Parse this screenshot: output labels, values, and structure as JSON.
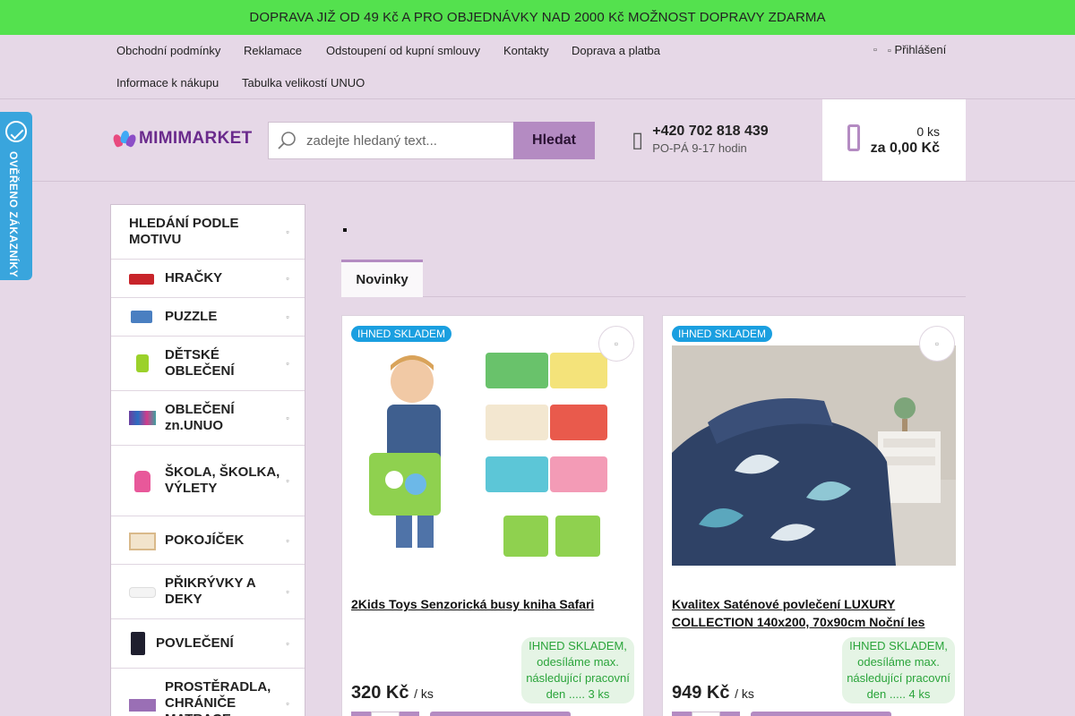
{
  "promo": "DOPRAVA JIŽ OD 49 Kč A PRO OBJEDNÁVKY NAD 2000 Kč MOŽNOST DOPRAVY ZDARMA",
  "topnav": {
    "links": [
      "Obchodní podmínky",
      "Reklamace",
      "Odstoupení od kupní smlouvy",
      "Kontakty",
      "Doprava a platba",
      "Informace k nákupu",
      "Tabulka velikostí UNUO"
    ],
    "login": "Přihlášení"
  },
  "header": {
    "logo": "MIMIMARKET",
    "search_placeholder": "zadejte hledaný text...",
    "search_button": "Hledat",
    "phone": "+420 702 818 439",
    "hours": "PO-PÁ 9-17 hodin",
    "cart_count": "0 ks",
    "cart_total": "za 0,00 Kč"
  },
  "verified_badge": "OVĚŘENO ZÁKAZNÍKY",
  "sidebar": {
    "items": [
      {
        "label": "HLEDÁNÍ PODLE MOTIVU",
        "thumb": "none"
      },
      {
        "label": "HRAČKY",
        "thumb": "truck"
      },
      {
        "label": "PUZZLE",
        "thumb": "puzzle"
      },
      {
        "label": "DĚTSKÉ OBLEČENÍ",
        "thumb": "jacket"
      },
      {
        "label": "OBLEČENÍ zn.UNUO",
        "thumb": "kids"
      },
      {
        "label": "ŠKOLA, ŠKOLKA, VÝLETY",
        "thumb": "backpack"
      },
      {
        "label": "POKOJÍČEK",
        "thumb": "crib"
      },
      {
        "label": "PŘIKRÝVKY A DEKY",
        "thumb": "blanket"
      },
      {
        "label": "POVLEČENÍ",
        "thumb": "bedding"
      },
      {
        "label": "PROSTĚRADLA, CHRÁNIČE MATRACE",
        "thumb": "sheet"
      }
    ]
  },
  "main": {
    "tab": "Novinky",
    "products": [
      {
        "badge": "IHNED SKLADEM",
        "title": "2Kids Toys Senzorická busy kniha Safari",
        "availability": "IHNED SKLADEM, odesíláme max. následující pracovní den ..... 3 ks",
        "price": "320 Kč",
        "unit": "/ ks"
      },
      {
        "badge": "IHNED SKLADEM",
        "title": "Kvalitex Saténové povlečení LUXURY COLLECTION 140x200, 70x90cm Noční les",
        "availability": "IHNED SKLADEM, odesíláme max. následující pracovní den ..... 4 ks",
        "price": "949 Kč",
        "unit": "/ ks"
      }
    ]
  },
  "colors": {
    "promo": "#54e14e",
    "accent": "#b48bc2",
    "page_bg": "#e6d8e7",
    "stock_tag": "#1a9fe0",
    "availability": "#2aa43a"
  }
}
